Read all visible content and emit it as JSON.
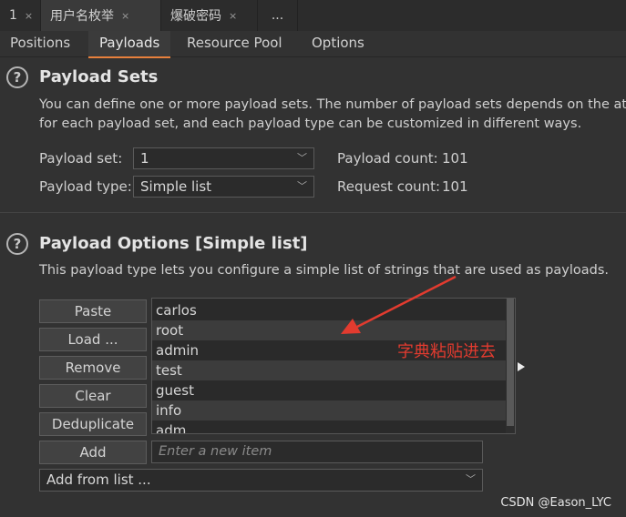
{
  "window_tabs": [
    {
      "label": "1",
      "close": "×"
    },
    {
      "label": "用户名枚举",
      "close": "×"
    },
    {
      "label": "爆破密码",
      "close": "×"
    },
    {
      "label": "..."
    }
  ],
  "section_tabs": [
    "Positions",
    "Payloads",
    "Resource Pool",
    "Options"
  ],
  "active_section_tab": "Payloads",
  "payload_sets": {
    "help_glyph": "?",
    "title": "Payload Sets",
    "desc_line1": "You can define one or more payload sets. The number of payload sets depends on the at",
    "desc_line2": "for each payload set, and each payload type can be customized in different ways.",
    "set_label": "Payload set:",
    "set_value": "1",
    "type_label": "Payload type:",
    "type_value": "Simple list",
    "payload_count_label": "Payload count:",
    "payload_count": "101",
    "request_count_label": "Request count:",
    "request_count": "101",
    "chevron": "﹀"
  },
  "payload_options": {
    "help_glyph": "?",
    "title": "Payload Options [Simple list]",
    "desc": "This payload type lets you configure a simple list of strings that are used as payloads.",
    "buttons": {
      "paste": "Paste",
      "load": "Load ...",
      "remove": "Remove",
      "clear": "Clear",
      "deduplicate": "Deduplicate",
      "add": "Add"
    },
    "list_items": [
      "carlos",
      "root",
      "admin",
      "test",
      "guest",
      "info",
      "adm"
    ],
    "new_item_placeholder": "Enter a new item",
    "add_from_list": "Add from list ..."
  },
  "annotation": {
    "text": "字典粘贴进去",
    "color": "#e23b2f"
  },
  "watermark": "CSDN @Eason_LYC",
  "colors": {
    "accent": "#e8803c",
    "background": "#323232"
  }
}
